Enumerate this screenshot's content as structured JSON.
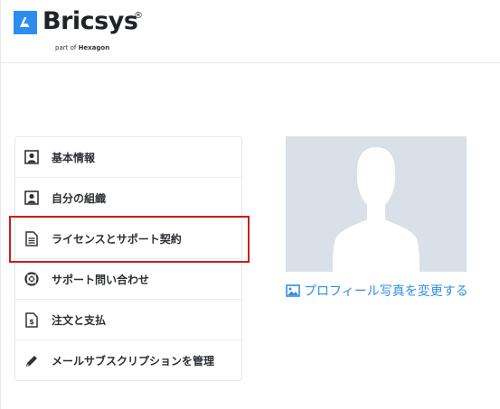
{
  "header": {
    "brand": "Bricsys",
    "registered": "®",
    "tagline_prefix": "part of",
    "tagline_company": "Hexagon",
    "brand_color": "#2d8cf0"
  },
  "menu": {
    "items": [
      {
        "label": "基本情報",
        "icon": "user-square-icon"
      },
      {
        "label": "自分の組織",
        "icon": "user-square-icon"
      },
      {
        "label": "ライセンスとサポート契約",
        "icon": "document-icon",
        "active": true
      },
      {
        "label": "サポート問い合わせ",
        "icon": "lifebuoy-icon"
      },
      {
        "label": "注文と支払",
        "icon": "invoice-icon"
      },
      {
        "label": "メールサブスクリプションを管理",
        "icon": "pen-icon"
      }
    ],
    "active_outline_color": "#c81e1e"
  },
  "profile": {
    "change_photo_label": "プロフィール写真を変更する",
    "link_color": "#2f8fe8",
    "avatar_bg": "#d9e0e7"
  }
}
